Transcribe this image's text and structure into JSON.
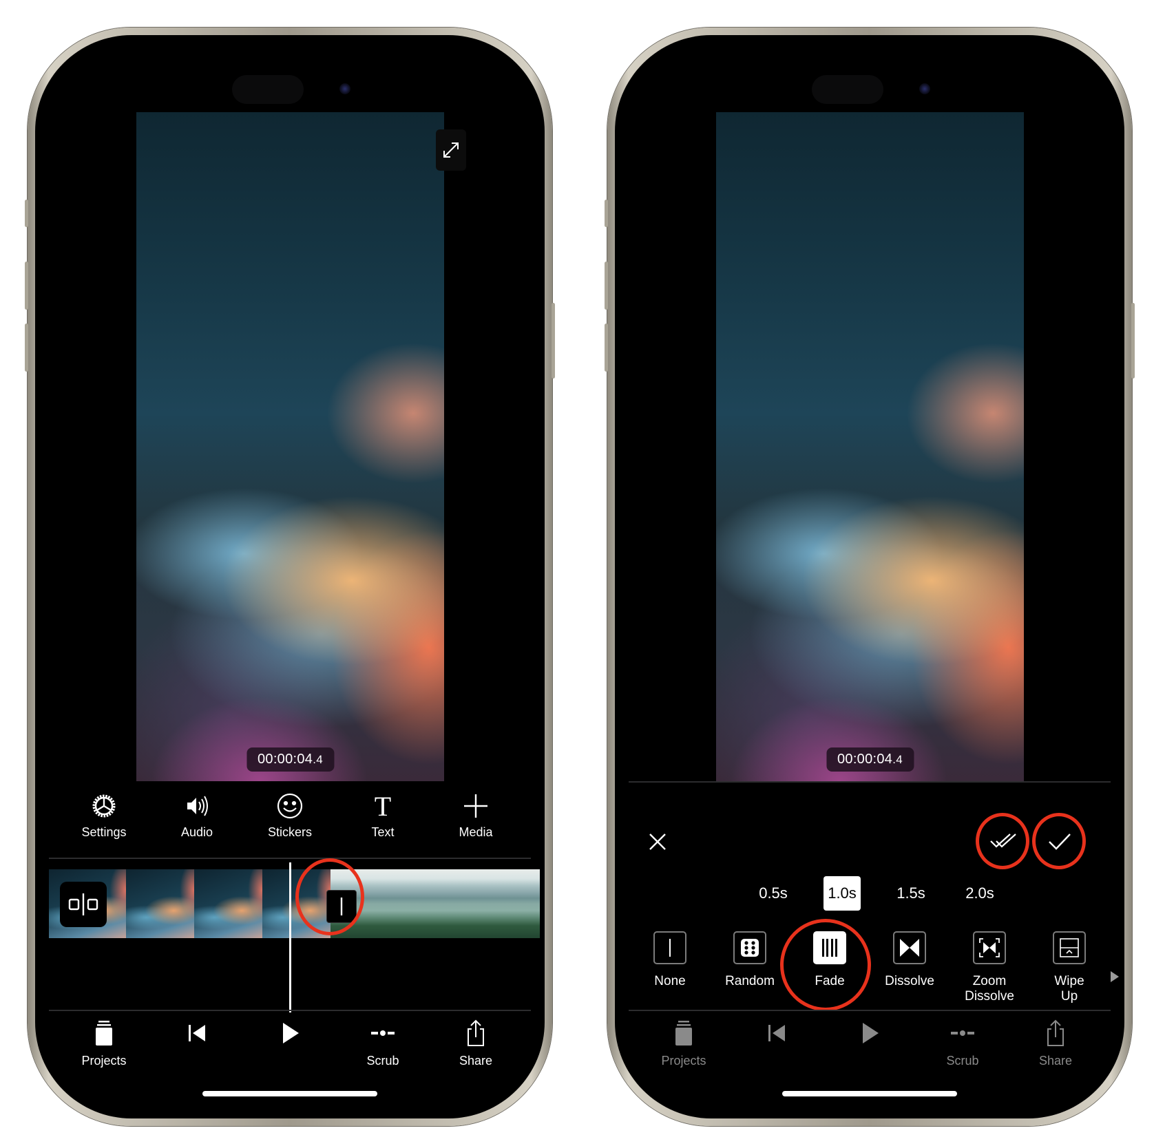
{
  "left_phone": {
    "video": {
      "timecode_main": "00:00:04",
      "timecode_fraction": ".4",
      "expand_icon": "expand-icon"
    },
    "tools": [
      {
        "label": "Settings",
        "icon": "settings-gear-icon"
      },
      {
        "label": "Audio",
        "icon": "speaker-icon"
      },
      {
        "label": "Stickers",
        "icon": "smiley-icon"
      },
      {
        "label": "Text",
        "icon": "text-t-icon"
      },
      {
        "label": "Media",
        "icon": "plus-icon"
      }
    ],
    "timeline": {
      "clip_badge_icon": "clip-split-icon",
      "transition_badge_icon": "transition-none-icon",
      "clips": [
        "abstract-wallpaper",
        "landscape-forest"
      ]
    },
    "bottom_bar": [
      {
        "label": "Projects",
        "icon": "projects-icon"
      },
      {
        "label": "",
        "icon": "skip-back-icon"
      },
      {
        "label": "",
        "icon": "play-icon"
      },
      {
        "label": "Scrub",
        "icon": "scrub-icon"
      },
      {
        "label": "Share",
        "icon": "share-icon"
      }
    ]
  },
  "right_phone": {
    "video": {
      "timecode_main": "00:00:04",
      "timecode_fraction": ".4"
    },
    "header": {
      "close_icon": "close-icon",
      "apply_all_icon": "double-check-icon",
      "apply_icon": "check-icon"
    },
    "durations": [
      {
        "label": "0.5s",
        "selected": false
      },
      {
        "label": "1.0s",
        "selected": true
      },
      {
        "label": "1.5s",
        "selected": false
      },
      {
        "label": "2.0s",
        "selected": false
      }
    ],
    "transitions": [
      {
        "label": "None",
        "icon": "none-transition-icon",
        "selected": false
      },
      {
        "label": "Random",
        "icon": "dice-icon",
        "selected": false
      },
      {
        "label": "Fade",
        "icon": "fade-bars-icon",
        "selected": true
      },
      {
        "label": "Dissolve",
        "icon": "bowtie-icon",
        "selected": false
      },
      {
        "label": "Zoom\nDissolve",
        "label_line1": "Zoom",
        "label_line2": "Dissolve",
        "icon": "zoom-bowtie-icon",
        "selected": false
      },
      {
        "label": "Wipe\nUp",
        "label_line1": "Wipe",
        "label_line2": "Up",
        "icon": "wipe-up-icon",
        "selected": false
      }
    ],
    "bottom_bar": [
      {
        "label": "Projects",
        "icon": "projects-icon"
      },
      {
        "label": "",
        "icon": "skip-back-icon"
      },
      {
        "label": "",
        "icon": "play-icon"
      },
      {
        "label": "Scrub",
        "icon": "scrub-icon"
      },
      {
        "label": "Share",
        "icon": "share-icon"
      }
    ]
  },
  "colors": {
    "highlight_ring": "#e8321c",
    "background": "#000000",
    "text": "#ffffff",
    "disabled_text": "#8a8a8a"
  }
}
